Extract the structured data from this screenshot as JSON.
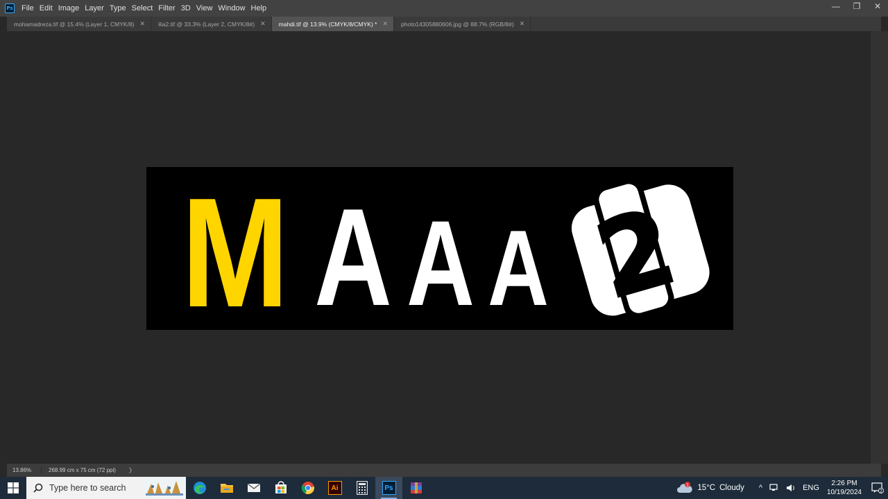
{
  "app": {
    "logo": "Ps",
    "menu": [
      "File",
      "Edit",
      "Image",
      "Layer",
      "Type",
      "Select",
      "Filter",
      "3D",
      "View",
      "Window",
      "Help"
    ],
    "window_controls": {
      "minimize": "—",
      "restore": "❐",
      "close": "✕"
    }
  },
  "tabs": [
    {
      "label": "mohamadreza.tif @ 15.4% (Layer 1, CMYK/8)",
      "active": false
    },
    {
      "label": "ilia2.tif @ 33.3% (Layer 2, CMYK/8#)",
      "active": false
    },
    {
      "label": "mahdi.tif @ 13.9% (CMYK/8/CMYK) *",
      "active": true
    },
    {
      "label": "photo14305880606.jpg @ 88.7% (RGB/8#)",
      "active": false
    }
  ],
  "canvas": {
    "background": "#000000",
    "letters": [
      "M",
      "A",
      "A",
      "A"
    ],
    "logo_text": "2",
    "colors": {
      "accent": "#ffd500",
      "white": "#ffffff"
    }
  },
  "status": {
    "zoom": "13.86%",
    "doc_size": "268.99 cm x 75 cm (72 ppi)",
    "arrow": "〉"
  },
  "taskbar": {
    "search_placeholder": "Type here to search",
    "apps": [
      {
        "icon": "edge-icon",
        "active": false
      },
      {
        "icon": "file-explorer-icon",
        "active": false
      },
      {
        "icon": "mail-icon",
        "active": false
      },
      {
        "icon": "store-icon",
        "active": false
      },
      {
        "icon": "chrome-icon",
        "active": false
      },
      {
        "icon": "illustrator-icon",
        "label": "Ai",
        "active": false
      },
      {
        "icon": "calculator-icon",
        "active": false
      },
      {
        "icon": "photoshop-icon",
        "label": "Ps",
        "active": true
      },
      {
        "icon": "winrar-icon",
        "active": false
      }
    ],
    "weather": {
      "temp": "15°C",
      "condition": "Cloudy",
      "badge": "1"
    },
    "language": "ENG",
    "time": "2:26 PM",
    "date": "10/19/2024",
    "notification_badge": "2"
  }
}
